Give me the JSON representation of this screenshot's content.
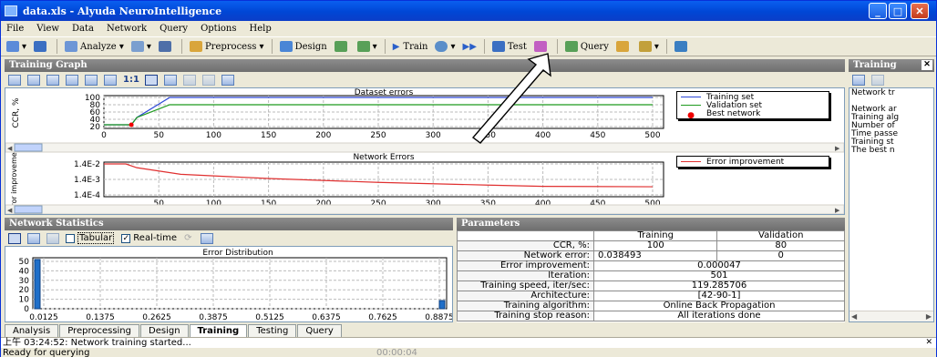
{
  "window": {
    "title": "data.xls - Alyuda NeuroIntelligence"
  },
  "menu": [
    "File",
    "View",
    "Data",
    "Network",
    "Query",
    "Options",
    "Help"
  ],
  "toolbar": {
    "analyze": "Analyze",
    "preprocess": "Preprocess",
    "design": "Design",
    "train": "Train",
    "test": "Test",
    "query": "Query"
  },
  "training_graph": {
    "header": "Training Graph",
    "zoom_label": "1:1",
    "dataset_errors": {
      "title": "Dataset errors",
      "ylabel": "CCR, %",
      "yticks": [
        "100",
        "80",
        "60",
        "40",
        "20"
      ],
      "xticks": [
        "0",
        "50",
        "100",
        "150",
        "200",
        "250",
        "300",
        "350",
        "400",
        "450",
        "500"
      ],
      "legend": [
        "Training set",
        "Validation set",
        "Best network"
      ]
    },
    "network_errors": {
      "title": "Network Errors",
      "ylabel": "Error improvement",
      "yticks": [
        "1.4E-2",
        "1.4E-3",
        "1.4E-4"
      ],
      "xticks": [
        "50",
        "100",
        "150",
        "200",
        "250",
        "300",
        "350",
        "400",
        "450",
        "500"
      ],
      "legend": [
        "Error improvement"
      ]
    }
  },
  "network_statistics": {
    "header": "Network Statistics",
    "tabular": "Tabular",
    "realtime": "Real-time",
    "chart_title": "Error Distribution",
    "yticks": [
      "50",
      "40",
      "30",
      "20",
      "10",
      "0"
    ],
    "xticks": [
      "0.0125",
      "0.1375",
      "0.2625",
      "0.3875",
      "0.5125",
      "0.6375",
      "0.7625",
      "0.8875"
    ]
  },
  "parameters": {
    "header": "Parameters",
    "col_training": "Training",
    "col_validation": "Validation",
    "rows": [
      {
        "label": "CCR, %:",
        "training": "100",
        "validation": "80"
      },
      {
        "label": "Network error:",
        "training": "0.038493",
        "validation": "0"
      },
      {
        "label": "Error improvement:",
        "value": "0.000047"
      },
      {
        "label": "Iteration:",
        "value": "501"
      },
      {
        "label": "Training speed, iter/sec:",
        "value": "119.285706"
      },
      {
        "label": "Architecture:",
        "value": "[42-90-1]"
      },
      {
        "label": "Training algorithm:",
        "value": "Online Back Propagation"
      },
      {
        "label": "Training stop reason:",
        "value": "All iterations done"
      }
    ]
  },
  "training_side": {
    "header": "Training",
    "lines": [
      "Network tr",
      "Network ar",
      "Training alg",
      "Number of",
      "Time passe",
      "Training st",
      "The best n"
    ]
  },
  "tabs": [
    "Analysis",
    "Preprocessing",
    "Design",
    "Training",
    "Testing",
    "Query"
  ],
  "active_tab": "Training",
  "output_line": "上午 03:24:52: Network training started...",
  "status": {
    "text": "Ready for querying",
    "timer": "00:00:04"
  },
  "chart_data": [
    {
      "type": "line",
      "title": "Dataset errors",
      "ylabel": "CCR, %",
      "ylim": [
        20,
        100
      ],
      "xlim": [
        0,
        500
      ],
      "series": [
        {
          "name": "Training set",
          "x": [
            0,
            25,
            30,
            60,
            500
          ],
          "values": [
            25,
            25,
            45,
            100,
            100
          ]
        },
        {
          "name": "Validation set",
          "x": [
            0,
            25,
            30,
            60,
            500
          ],
          "values": [
            25,
            25,
            45,
            80,
            80
          ]
        },
        {
          "name": "Best network",
          "x": [
            25
          ],
          "values": [
            25
          ]
        }
      ]
    },
    {
      "type": "line",
      "title": "Network Errors",
      "ylabel": "Error improvement",
      "xlim": [
        0,
        500
      ],
      "series": [
        {
          "name": "Error improvement",
          "x": [
            0,
            20,
            30,
            70,
            150,
            250,
            350,
            400,
            500
          ],
          "values": [
            0.014,
            0.014,
            0.008,
            0.003,
            0.0016,
            0.0009,
            0.0006,
            0.0005,
            0.00047
          ]
        }
      ]
    },
    {
      "type": "bar",
      "title": "Error Distribution",
      "categories": [
        "0.0125",
        "0.1375",
        "0.2625",
        "0.3875",
        "0.5125",
        "0.6375",
        "0.7625",
        "0.8875"
      ],
      "values": [
        55,
        0,
        0,
        0,
        0,
        0,
        0,
        0
      ]
    }
  ]
}
